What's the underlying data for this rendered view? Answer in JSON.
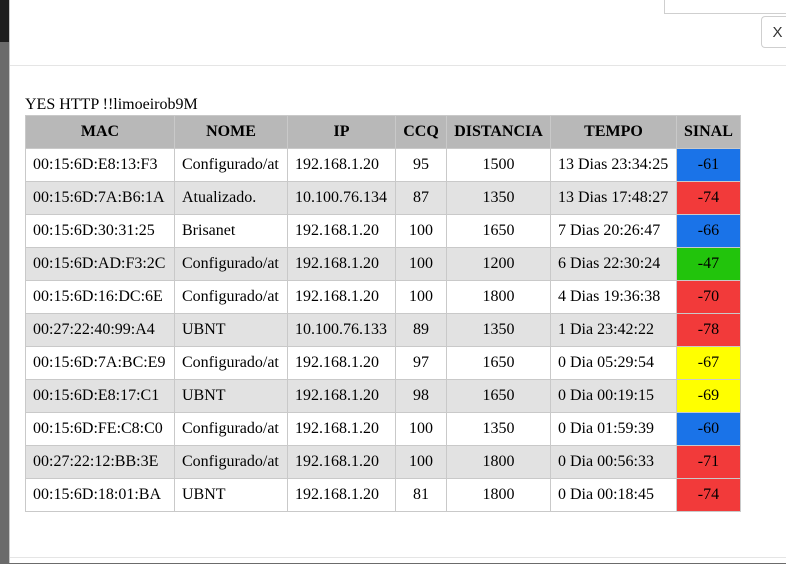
{
  "modal": {
    "close_label": "X",
    "heading": "YES HTTP !!limoeirob9M"
  },
  "table": {
    "columns": [
      "MAC",
      "NOME",
      "IP",
      "CCQ",
      "DISTANCIA",
      "TEMPO",
      "SINAL"
    ],
    "rows": [
      {
        "mac": "00:15:6D:E8:13:F3",
        "nome": "Configurado/at",
        "ip": "192.168.1.20",
        "ccq": "95",
        "distancia": "1500",
        "tempo": "13 Dias 23:34:25",
        "sinal": "-61",
        "color": "#1a73e8"
      },
      {
        "mac": "00:15:6D:7A:B6:1A",
        "nome": "Atualizado.",
        "ip": "10.100.76.134",
        "ccq": "87",
        "distancia": "1350",
        "tempo": "13 Dias 17:48:27",
        "sinal": "-74",
        "color": "#f23a3a"
      },
      {
        "mac": "00:15:6D:30:31:25",
        "nome": "Brisanet",
        "ip": "192.168.1.20",
        "ccq": "100",
        "distancia": "1650",
        "tempo": "7 Dias 20:26:47",
        "sinal": "-66",
        "color": "#1a73e8"
      },
      {
        "mac": "00:15:6D:AD:F3:2C",
        "nome": "Configurado/at",
        "ip": "192.168.1.20",
        "ccq": "100",
        "distancia": "1200",
        "tempo": "6 Dias 22:30:24",
        "sinal": "-47",
        "color": "#22c40c"
      },
      {
        "mac": "00:15:6D:16:DC:6E",
        "nome": "Configurado/at",
        "ip": "192.168.1.20",
        "ccq": "100",
        "distancia": "1800",
        "tempo": "4 Dias 19:36:38",
        "sinal": "-70",
        "color": "#f23a3a"
      },
      {
        "mac": "00:27:22:40:99:A4",
        "nome": "UBNT",
        "ip": "10.100.76.133",
        "ccq": "89",
        "distancia": "1350",
        "tempo": "1 Dia 23:42:22",
        "sinal": "-78",
        "color": "#f23a3a"
      },
      {
        "mac": "00:15:6D:7A:BC:E9",
        "nome": "Configurado/at",
        "ip": "192.168.1.20",
        "ccq": "97",
        "distancia": "1650",
        "tempo": "0 Dia 05:29:54",
        "sinal": "-67",
        "color": "#ffff00"
      },
      {
        "mac": "00:15:6D:E8:17:C1",
        "nome": "UBNT",
        "ip": "192.168.1.20",
        "ccq": "98",
        "distancia": "1650",
        "tempo": "0 Dia 00:19:15",
        "sinal": "-69",
        "color": "#ffff00"
      },
      {
        "mac": "00:15:6D:FE:C8:C0",
        "nome": "Configurado/at",
        "ip": "192.168.1.20",
        "ccq": "100",
        "distancia": "1350",
        "tempo": "0 Dia 01:59:39",
        "sinal": "-60",
        "color": "#1a73e8"
      },
      {
        "mac": "00:27:22:12:BB:3E",
        "nome": "Configurado/at",
        "ip": "192.168.1.20",
        "ccq": "100",
        "distancia": "1800",
        "tempo": "0 Dia 00:56:33",
        "sinal": "-71",
        "color": "#f23a3a"
      },
      {
        "mac": "00:15:6D:18:01:BA",
        "nome": "UBNT",
        "ip": "192.168.1.20",
        "ccq": "81",
        "distancia": "1800",
        "tempo": "0 Dia 00:18:45",
        "sinal": "-74",
        "color": "#f23a3a"
      }
    ]
  }
}
